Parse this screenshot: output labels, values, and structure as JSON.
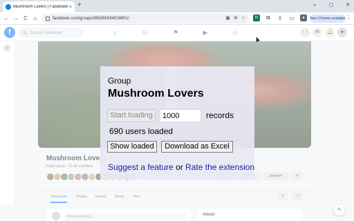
{
  "browser": {
    "tab_title": "Mushroom Lovers | Facebook",
    "tab_close": "×",
    "new_tab": "+",
    "url": "facebook.com/groups/350260184016801/",
    "chrome_badge": "New Chrome available",
    "window_controls": [
      "⌄",
      "–",
      "▢",
      "✕"
    ],
    "nav": [
      "←",
      "→",
      "C",
      "⌂"
    ],
    "omnibox_icons": [
      "▣",
      "⊕",
      "☆"
    ],
    "extensions": [
      {
        "icon": "n-ext-icon",
        "glyph": "N",
        "color": "#0b7a4b"
      },
      {
        "icon": "puzzle-icon",
        "glyph": "⧉",
        "color": ""
      },
      {
        "icon": "download-icon",
        "glyph": "⇩",
        "color": ""
      },
      {
        "icon": "cast-icon",
        "glyph": "▭",
        "color": ""
      },
      {
        "icon": "profile-icon",
        "glyph": "●",
        "color": "#5a6a7a"
      }
    ],
    "menu": "⋮"
  },
  "facebook": {
    "logo": "f",
    "search_placeholder": "Search Facebook",
    "search_icon": "🔍",
    "nav_icons": [
      "⌂",
      "⚇",
      "⚑",
      "▶",
      "☺"
    ],
    "right_icons": [
      "⋮⋮",
      "✉",
      "🔔",
      "●"
    ]
  },
  "group_page": {
    "title": "Mushroom Lovers",
    "subtitle": "Public group · 15.3K members",
    "join_label": "Joined ▾",
    "share_label": "Share",
    "invite_label": "",
    "more_label": "▾",
    "tabs": [
      "Discussion",
      "People",
      "Events",
      "Media",
      "Files"
    ],
    "write_placeholder": "Write something...",
    "about_title": "About",
    "avatar_colors": [
      "#8b6f4e",
      "#c9a57a",
      "#6b7c5a",
      "#9aa0a8",
      "#b88d6a",
      "#7d8c9e",
      "#d0b38a",
      "#5e6e4f",
      "#a58f7a",
      "#8e98a6",
      "#c4a488",
      "#6f7d63",
      "#b2aaa0"
    ]
  },
  "popup": {
    "heading": "Group",
    "group_name": "Mushroom Lovers",
    "start_button": "Start loading",
    "record_count": "1000",
    "records_label": "records",
    "status": "690 users loaded",
    "show_button": "Show loaded",
    "download_button": "Download as Excel",
    "suggest_link": "Suggest a feature",
    "or_text": " or ",
    "rate_link": "Rate the extension"
  }
}
